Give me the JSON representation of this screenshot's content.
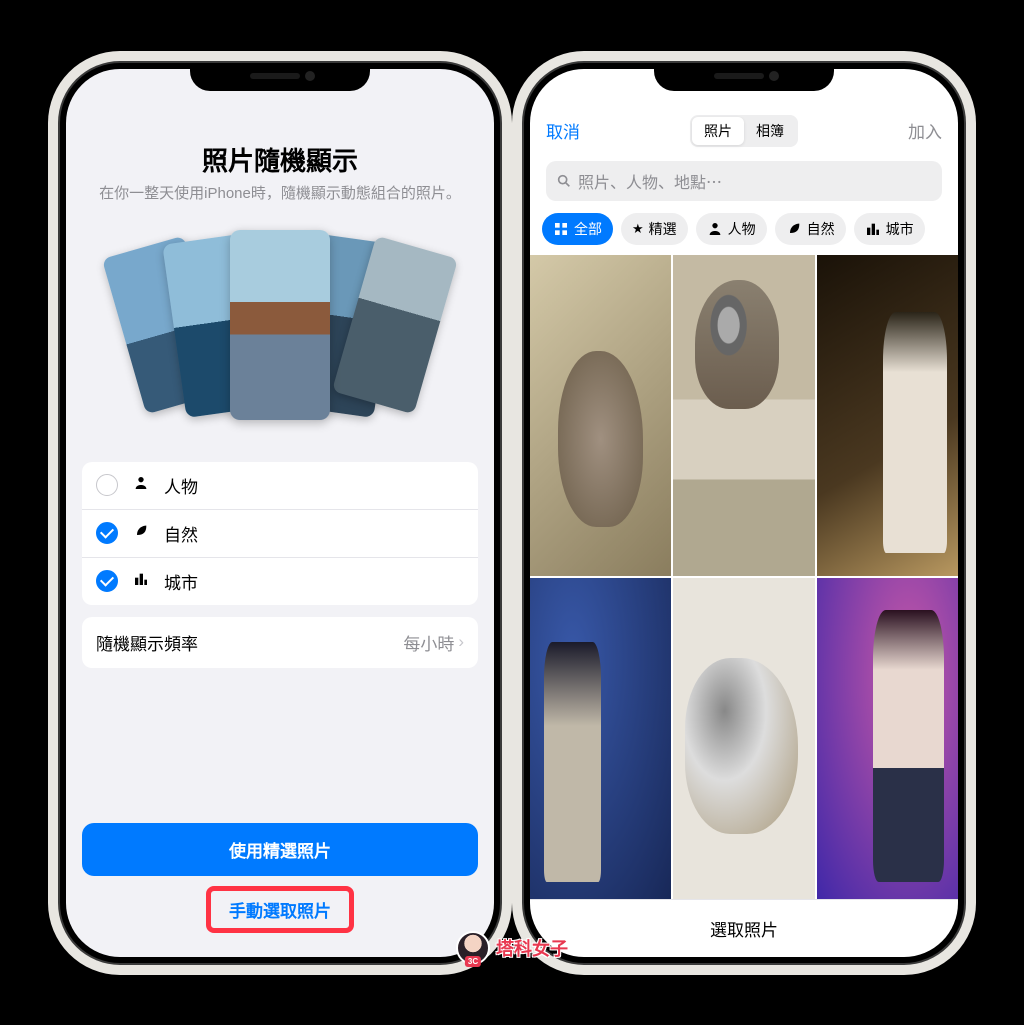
{
  "left": {
    "title": "照片隨機顯示",
    "subtitle": "在你一整天使用iPhone時，隨機顯示動態組合的照片。",
    "options": [
      {
        "label": "人物",
        "checked": false,
        "icon": "person"
      },
      {
        "label": "自然",
        "checked": true,
        "icon": "leaf"
      },
      {
        "label": "城市",
        "checked": true,
        "icon": "city"
      }
    ],
    "frequency": {
      "label": "隨機顯示頻率",
      "value": "每小時"
    },
    "primary_button": "使用精選照片",
    "secondary_button": "手動選取照片"
  },
  "right": {
    "cancel": "取消",
    "add": "加入",
    "segments": {
      "photos": "照片",
      "albums": "相簿",
      "active": "photos"
    },
    "search_placeholder": "照片、人物、地點⋯",
    "filters": [
      {
        "label": "全部",
        "icon": "grid",
        "active": true
      },
      {
        "label": "精選",
        "icon": "star",
        "active": false
      },
      {
        "label": "人物",
        "icon": "person",
        "active": false
      },
      {
        "label": "自然",
        "icon": "leaf",
        "active": false
      },
      {
        "label": "城市",
        "icon": "city",
        "active": false
      }
    ],
    "footer": "選取照片"
  },
  "watermark": {
    "text": "塔科女子",
    "badge": "3C"
  }
}
